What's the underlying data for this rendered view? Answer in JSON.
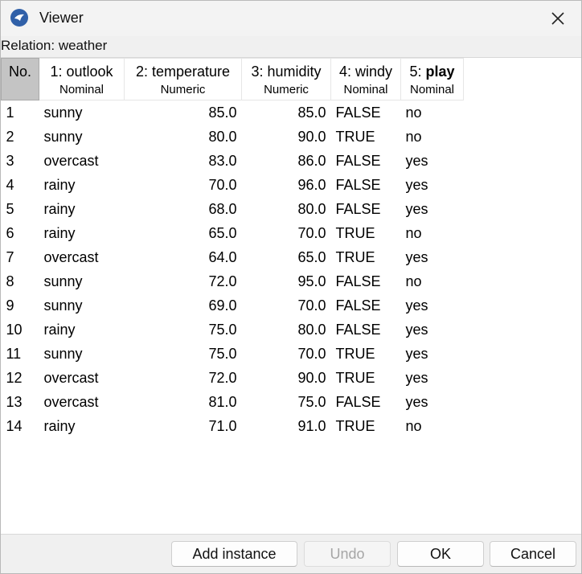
{
  "window": {
    "title": "Viewer"
  },
  "relation_label": "Relation: weather",
  "columns": [
    {
      "line1": "No.",
      "line2": ""
    },
    {
      "line1": "1: outlook",
      "line2": "Nominal"
    },
    {
      "line1": "2: temperature",
      "line2": "Numeric"
    },
    {
      "line1": "3: humidity",
      "line2": "Numeric"
    },
    {
      "line1": "4: windy",
      "line2": "Nominal"
    },
    {
      "line1_prefix": "5: ",
      "line1_bold": "play",
      "line2": "Nominal"
    }
  ],
  "rows": [
    [
      "1",
      "sunny",
      "85.0",
      "85.0",
      "FALSE",
      "no"
    ],
    [
      "2",
      "sunny",
      "80.0",
      "90.0",
      "TRUE",
      "no"
    ],
    [
      "3",
      "overcast",
      "83.0",
      "86.0",
      "FALSE",
      "yes"
    ],
    [
      "4",
      "rainy",
      "70.0",
      "96.0",
      "FALSE",
      "yes"
    ],
    [
      "5",
      "rainy",
      "68.0",
      "80.0",
      "FALSE",
      "yes"
    ],
    [
      "6",
      "rainy",
      "65.0",
      "70.0",
      "TRUE",
      "no"
    ],
    [
      "7",
      "overcast",
      "64.0",
      "65.0",
      "TRUE",
      "yes"
    ],
    [
      "8",
      "sunny",
      "72.0",
      "95.0",
      "FALSE",
      "no"
    ],
    [
      "9",
      "sunny",
      "69.0",
      "70.0",
      "FALSE",
      "yes"
    ],
    [
      "10",
      "rainy",
      "75.0",
      "80.0",
      "FALSE",
      "yes"
    ],
    [
      "11",
      "sunny",
      "75.0",
      "70.0",
      "TRUE",
      "yes"
    ],
    [
      "12",
      "overcast",
      "72.0",
      "90.0",
      "TRUE",
      "yes"
    ],
    [
      "13",
      "overcast",
      "81.0",
      "75.0",
      "FALSE",
      "yes"
    ],
    [
      "14",
      "rainy",
      "71.0",
      "91.0",
      "TRUE",
      "no"
    ]
  ],
  "buttons": {
    "add_instance": "Add instance",
    "undo": "Undo",
    "ok": "OK",
    "cancel": "Cancel"
  },
  "icons": {
    "app": "weka-bird-icon",
    "close": "close-icon"
  }
}
